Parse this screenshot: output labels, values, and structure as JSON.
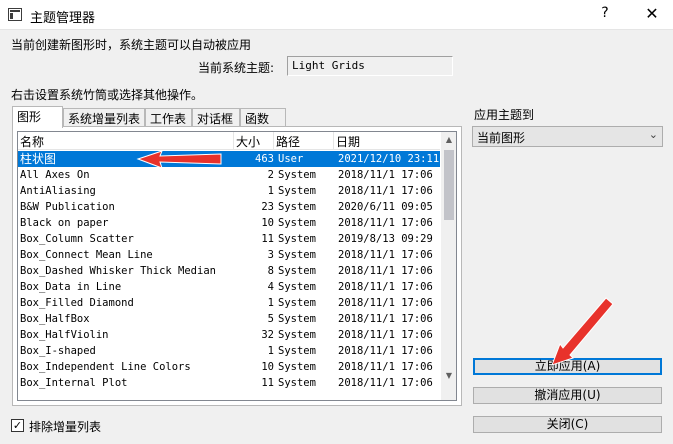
{
  "window": {
    "title": "主题管理器",
    "help_glyph": "?",
    "close_glyph": "✕"
  },
  "description": "当前创建新图形时，系统主题可以自动被应用",
  "current_theme": {
    "label": "当前系统主题:",
    "value": "Light Grids"
  },
  "instruction": "右击设置系统竹筒或选择其他操作。",
  "tabs": [
    {
      "label": "图形",
      "active": true
    },
    {
      "label": "系统增量列表",
      "active": false
    },
    {
      "label": "工作表",
      "active": false
    },
    {
      "label": "对话框",
      "active": false
    },
    {
      "label": "函数",
      "active": false
    }
  ],
  "table": {
    "columns": [
      "名称",
      "大小",
      "路径",
      "日期"
    ],
    "rows": [
      {
        "name": "柱状图",
        "size": "463",
        "path": "User",
        "date": "2021/12/10 23:11",
        "selected": true
      },
      {
        "name": "All Axes On",
        "size": "2",
        "path": "System",
        "date": "2018/11/1  17:06"
      },
      {
        "name": "AntiAliasing",
        "size": "1",
        "path": "System",
        "date": "2018/11/1  17:06"
      },
      {
        "name": "B&W Publication",
        "size": "23",
        "path": "System",
        "date": "2020/6/11 09:05"
      },
      {
        "name": "Black on paper",
        "size": "10",
        "path": "System",
        "date": "2018/11/1  17:06"
      },
      {
        "name": "Box_Column Scatter",
        "size": "11",
        "path": "System",
        "date": "2019/8/13 09:29"
      },
      {
        "name": "Box_Connect Mean Line",
        "size": "3",
        "path": "System",
        "date": "2018/11/1  17:06"
      },
      {
        "name": "Box_Dashed Whisker Thick Median",
        "size": "8",
        "path": "System",
        "date": "2018/11/1  17:06"
      },
      {
        "name": "Box_Data in Line",
        "size": "4",
        "path": "System",
        "date": "2018/11/1  17:06"
      },
      {
        "name": "Box_Filled Diamond",
        "size": "1",
        "path": "System",
        "date": "2018/11/1  17:06"
      },
      {
        "name": "Box_HalfBox",
        "size": "5",
        "path": "System",
        "date": "2018/11/1  17:06"
      },
      {
        "name": "Box_HalfViolin",
        "size": "32",
        "path": "System",
        "date": "2018/11/1  17:06"
      },
      {
        "name": "Box_I-shaped",
        "size": "1",
        "path": "System",
        "date": "2018/11/1  17:06"
      },
      {
        "name": "Box_Independent Line Colors",
        "size": "10",
        "path": "System",
        "date": "2018/11/1  17:06"
      },
      {
        "name": "Box_Internal Plot",
        "size": "11",
        "path": "System",
        "date": "2018/11/1  17:06"
      }
    ]
  },
  "apply_to": {
    "label": "应用主题到",
    "selected": "当前图形"
  },
  "buttons": {
    "apply_now": "立即应用(A)",
    "undo_apply": "撤消应用(U)",
    "close": "关闭(C)"
  },
  "exclude_checkbox": {
    "label": "排除增量列表",
    "checked": true,
    "check_glyph": "✓"
  },
  "colors": {
    "selection": "#0078d7",
    "annotation_arrow": "#e8322b"
  }
}
